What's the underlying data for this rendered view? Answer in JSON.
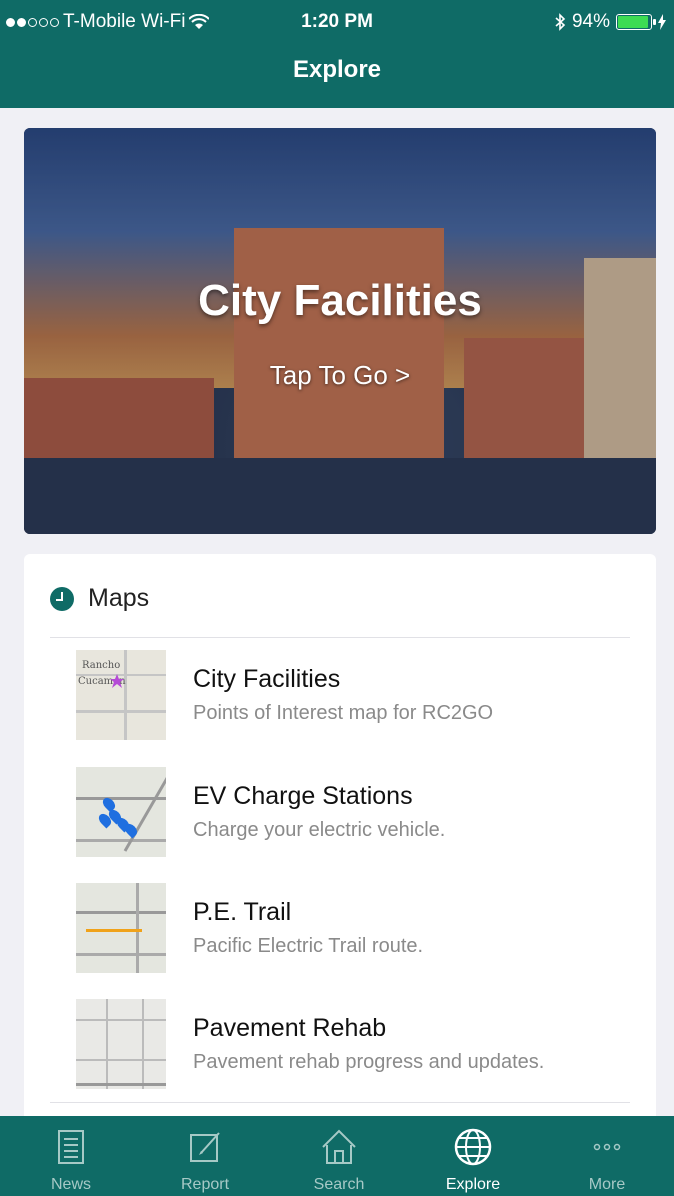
{
  "status_bar": {
    "carrier": "T-Mobile Wi-Fi",
    "time": "1:20 PM",
    "battery": "94%",
    "battery_level": 0.94
  },
  "nav": {
    "title": "Explore"
  },
  "hero": {
    "title": "City Facilities",
    "cta": "Tap To Go >"
  },
  "maps": {
    "heading": "Maps",
    "items": [
      {
        "title": "City Facilities",
        "subtitle": "Points of Interest map for RC2GO",
        "thumb_text_1": "Rancho",
        "thumb_text_2": "Cucamon"
      },
      {
        "title": "EV Charge Stations",
        "subtitle": "Charge your electric vehicle."
      },
      {
        "title": "P.E. Trail",
        "subtitle": "Pacific Electric Trail route."
      },
      {
        "title": "Pavement Rehab",
        "subtitle": "Pavement rehab progress and updates."
      }
    ]
  },
  "tabs": [
    {
      "label": "News",
      "icon": "news-icon",
      "active": false
    },
    {
      "label": "Report",
      "icon": "compose-icon",
      "active": false
    },
    {
      "label": "Search",
      "icon": "home-search-icon",
      "active": false
    },
    {
      "label": "Explore",
      "icon": "globe-icon",
      "active": true
    },
    {
      "label": "More",
      "icon": "more-dots-icon",
      "active": false
    }
  ],
  "colors": {
    "brand": "#0f6b66",
    "battery": "#3ddc53"
  }
}
